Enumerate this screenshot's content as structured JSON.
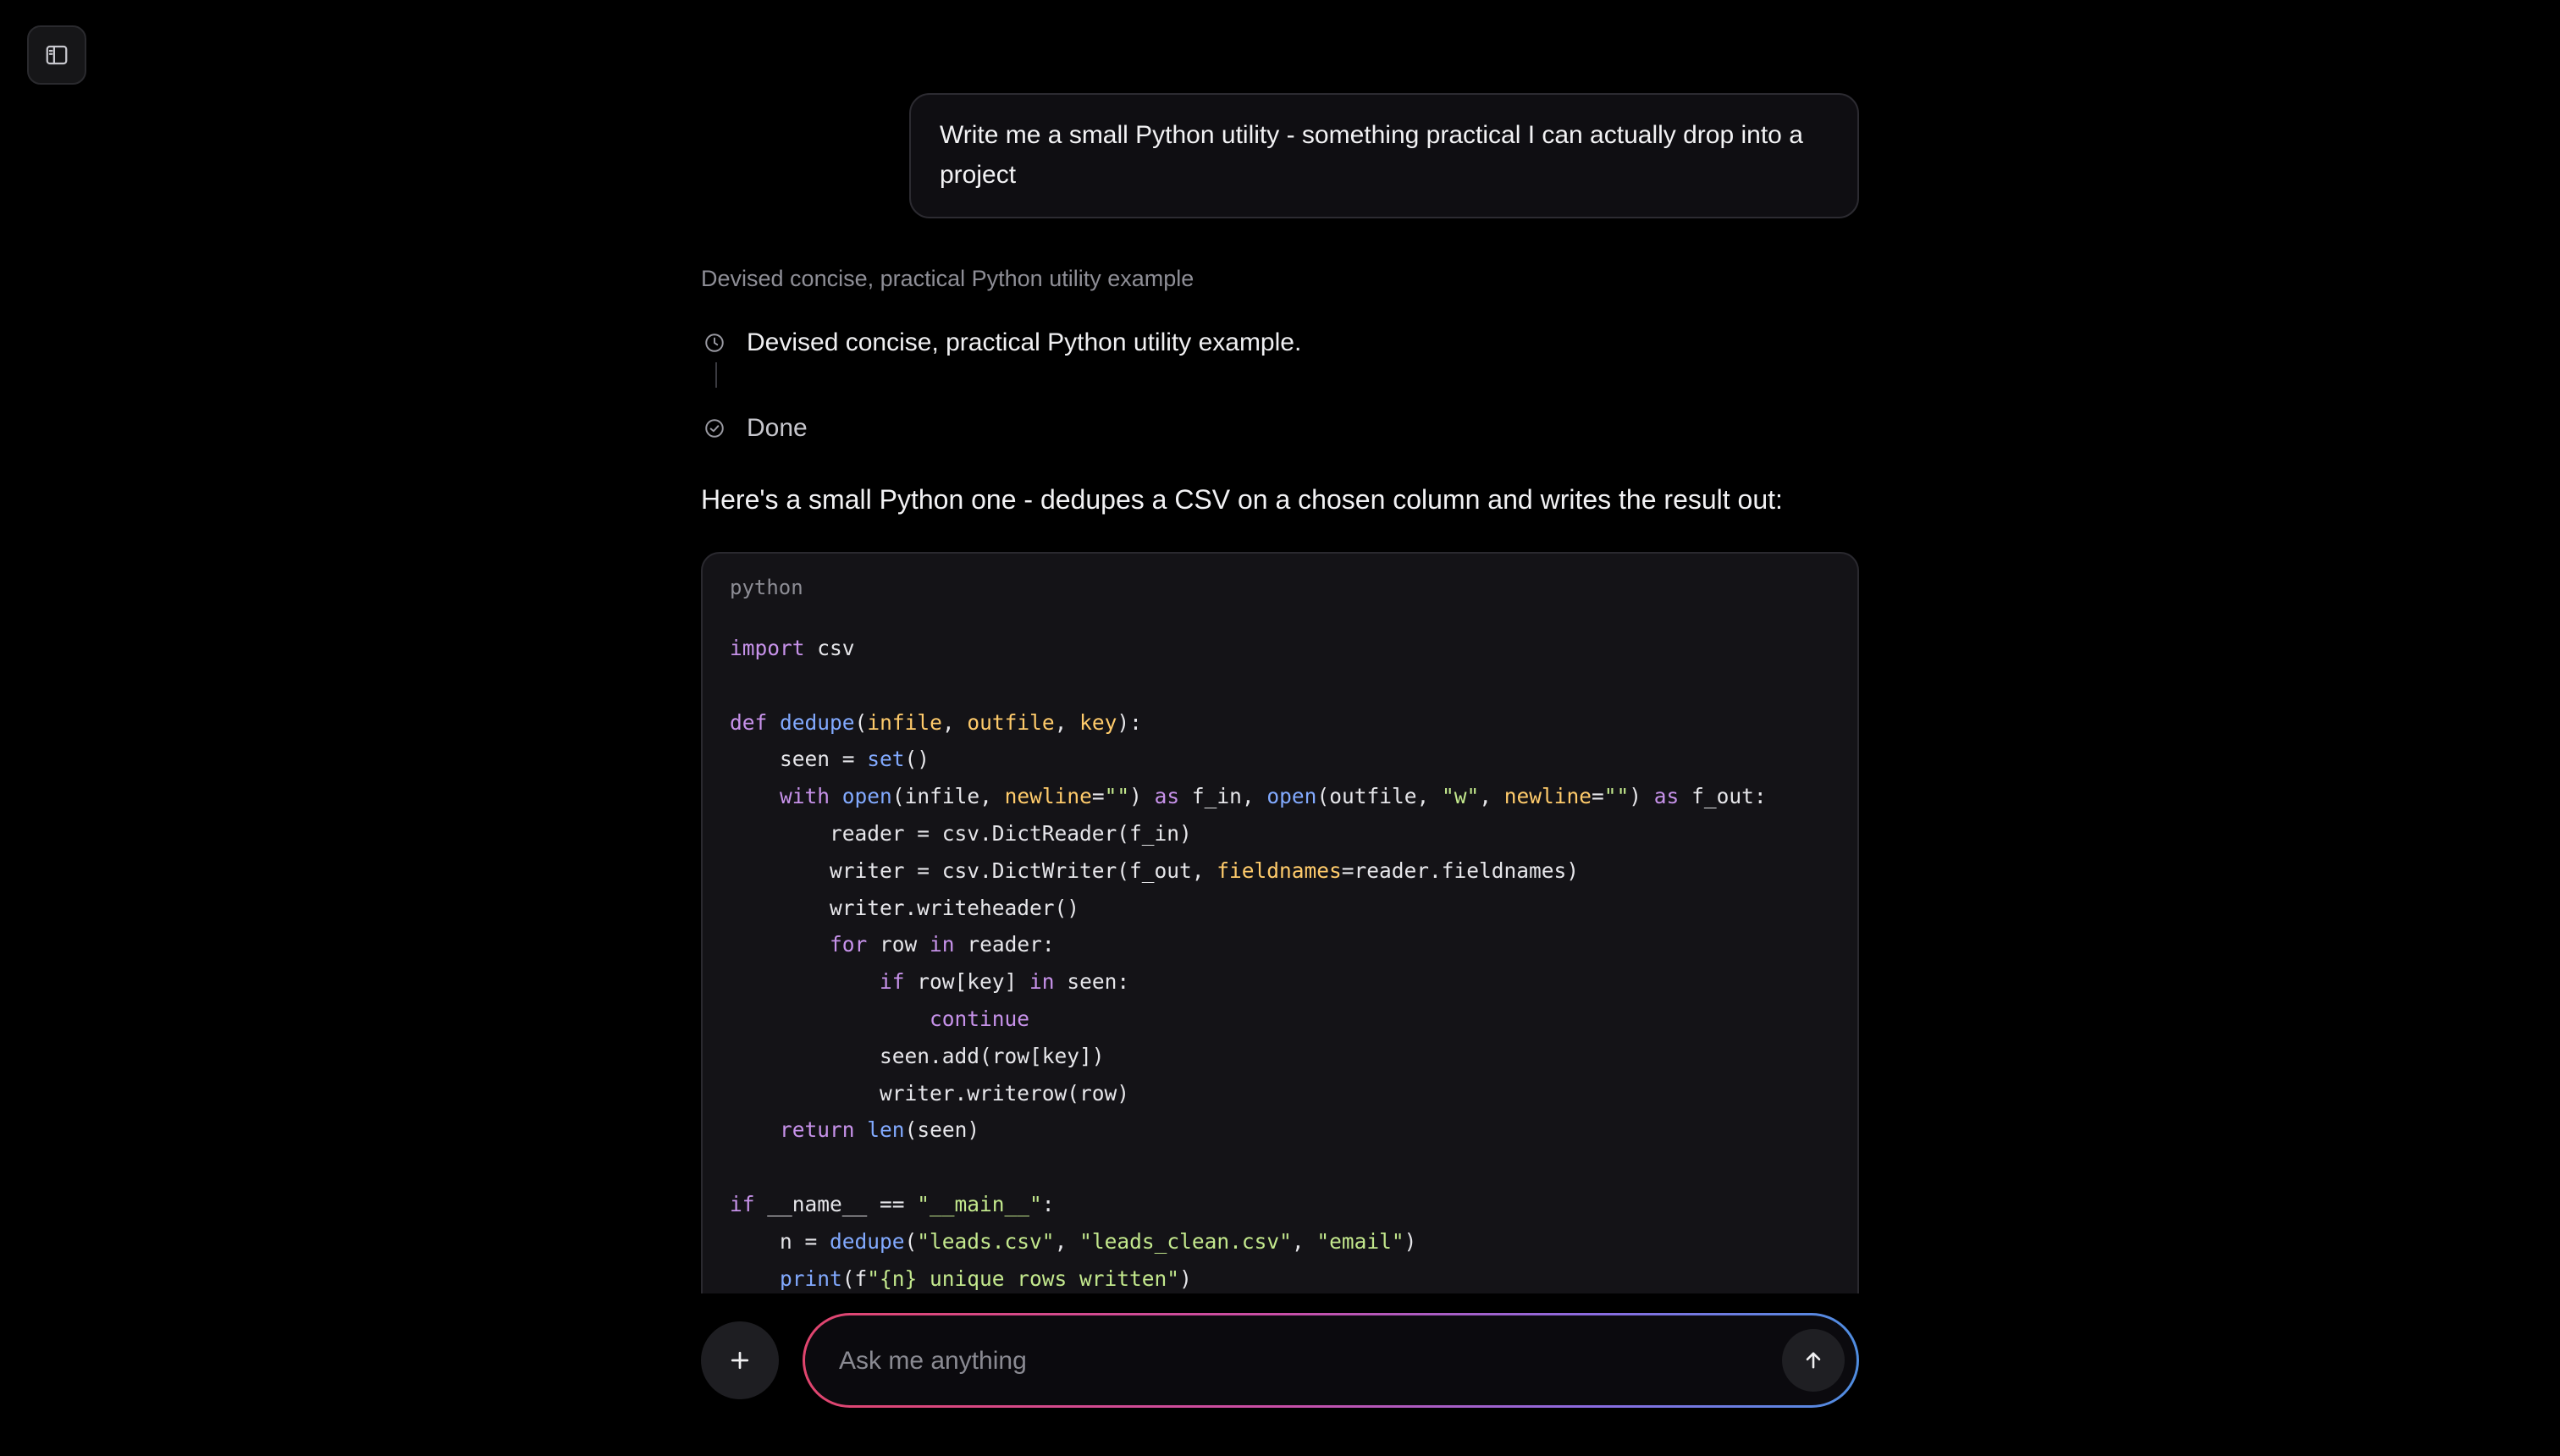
{
  "icons": {
    "sidebar_toggle": "sidebar-panel-icon",
    "thinking_step": "clock-icon",
    "done_step": "check-circle-icon",
    "attach": "plus-icon",
    "send": "arrow-up-icon"
  },
  "colors": {
    "background": "#000000",
    "keyword": "#c792ea",
    "function": "#82aaff",
    "parameter": "#ffcb6b",
    "string": "#c3e88d",
    "input_gradient": [
      "#e0456e",
      "#c94ea6",
      "#8a6be0",
      "#4f8de0"
    ]
  },
  "conversation": {
    "user_message": "Write me a small Python utility - something practical I can actually drop into a project",
    "thinking": {
      "summary": "Devised concise, practical Python utility example",
      "steps": [
        {
          "label": "Devised concise, practical Python utility example."
        },
        {
          "label": "Done"
        }
      ]
    },
    "answer_intro": "Here's a small Python one - dedupes a CSV on a chosen column and writes the result out:",
    "code_block": {
      "language": "python",
      "lines": [
        [
          {
            "t": "kw",
            "v": "import"
          },
          {
            "t": "plain",
            "v": " csv"
          }
        ],
        [],
        [
          {
            "t": "kw",
            "v": "def"
          },
          {
            "t": "plain",
            "v": " "
          },
          {
            "t": "fn",
            "v": "dedupe"
          },
          {
            "t": "plain",
            "v": "("
          },
          {
            "t": "param",
            "v": "infile"
          },
          {
            "t": "plain",
            "v": ", "
          },
          {
            "t": "param",
            "v": "outfile"
          },
          {
            "t": "plain",
            "v": ", "
          },
          {
            "t": "param",
            "v": "key"
          },
          {
            "t": "plain",
            "v": "):"
          }
        ],
        [
          {
            "t": "plain",
            "v": "    seen = "
          },
          {
            "t": "fn",
            "v": "set"
          },
          {
            "t": "plain",
            "v": "()"
          }
        ],
        [
          {
            "t": "plain",
            "v": "    "
          },
          {
            "t": "kw",
            "v": "with"
          },
          {
            "t": "plain",
            "v": " "
          },
          {
            "t": "fn",
            "v": "open"
          },
          {
            "t": "plain",
            "v": "(infile, "
          },
          {
            "t": "param",
            "v": "newline"
          },
          {
            "t": "plain",
            "v": "="
          },
          {
            "t": "str",
            "v": "\"\""
          },
          {
            "t": "plain",
            "v": ") "
          },
          {
            "t": "kw",
            "v": "as"
          },
          {
            "t": "plain",
            "v": " f_in, "
          },
          {
            "t": "fn",
            "v": "open"
          },
          {
            "t": "plain",
            "v": "(outfile, "
          },
          {
            "t": "str",
            "v": "\"w\""
          },
          {
            "t": "plain",
            "v": ", "
          },
          {
            "t": "param",
            "v": "newline"
          },
          {
            "t": "plain",
            "v": "="
          },
          {
            "t": "str",
            "v": "\"\""
          },
          {
            "t": "plain",
            "v": ") "
          },
          {
            "t": "kw",
            "v": "as"
          },
          {
            "t": "plain",
            "v": " f_out:"
          }
        ],
        [
          {
            "t": "plain",
            "v": "        reader = csv.DictReader(f_in)"
          }
        ],
        [
          {
            "t": "plain",
            "v": "        writer = csv.DictWriter(f_out, "
          },
          {
            "t": "param",
            "v": "fieldnames"
          },
          {
            "t": "plain",
            "v": "=reader.fieldnames)"
          }
        ],
        [
          {
            "t": "plain",
            "v": "        writer.writeheader()"
          }
        ],
        [
          {
            "t": "plain",
            "v": "        "
          },
          {
            "t": "kw",
            "v": "for"
          },
          {
            "t": "plain",
            "v": " row "
          },
          {
            "t": "kw",
            "v": "in"
          },
          {
            "t": "plain",
            "v": " reader:"
          }
        ],
        [
          {
            "t": "plain",
            "v": "            "
          },
          {
            "t": "kw",
            "v": "if"
          },
          {
            "t": "plain",
            "v": " row[key] "
          },
          {
            "t": "kw",
            "v": "in"
          },
          {
            "t": "plain",
            "v": " seen:"
          }
        ],
        [
          {
            "t": "plain",
            "v": "                "
          },
          {
            "t": "kw",
            "v": "continue"
          }
        ],
        [
          {
            "t": "plain",
            "v": "            seen.add(row[key])"
          }
        ],
        [
          {
            "t": "plain",
            "v": "            writer.writerow(row)"
          }
        ],
        [
          {
            "t": "plain",
            "v": "    "
          },
          {
            "t": "kw",
            "v": "return"
          },
          {
            "t": "plain",
            "v": " "
          },
          {
            "t": "fn",
            "v": "len"
          },
          {
            "t": "plain",
            "v": "(seen)"
          }
        ],
        [],
        [
          {
            "t": "kw",
            "v": "if"
          },
          {
            "t": "plain",
            "v": " __name__ == "
          },
          {
            "t": "str",
            "v": "\"__main__\""
          },
          {
            "t": "plain",
            "v": ":"
          }
        ],
        [
          {
            "t": "plain",
            "v": "    n = "
          },
          {
            "t": "fn",
            "v": "dedupe"
          },
          {
            "t": "plain",
            "v": "("
          },
          {
            "t": "str",
            "v": "\"leads.csv\""
          },
          {
            "t": "plain",
            "v": ", "
          },
          {
            "t": "str",
            "v": "\"leads_clean.csv\""
          },
          {
            "t": "plain",
            "v": ", "
          },
          {
            "t": "str",
            "v": "\"email\""
          },
          {
            "t": "plain",
            "v": ")"
          }
        ],
        [
          {
            "t": "plain",
            "v": "    "
          },
          {
            "t": "fn",
            "v": "print"
          },
          {
            "t": "plain",
            "v": "(f"
          },
          {
            "t": "str",
            "v": "\"{n} unique rows written\""
          },
          {
            "t": "plain",
            "v": ")"
          }
        ]
      ]
    }
  },
  "composer": {
    "placeholder": "Ask me anything",
    "value": ""
  }
}
